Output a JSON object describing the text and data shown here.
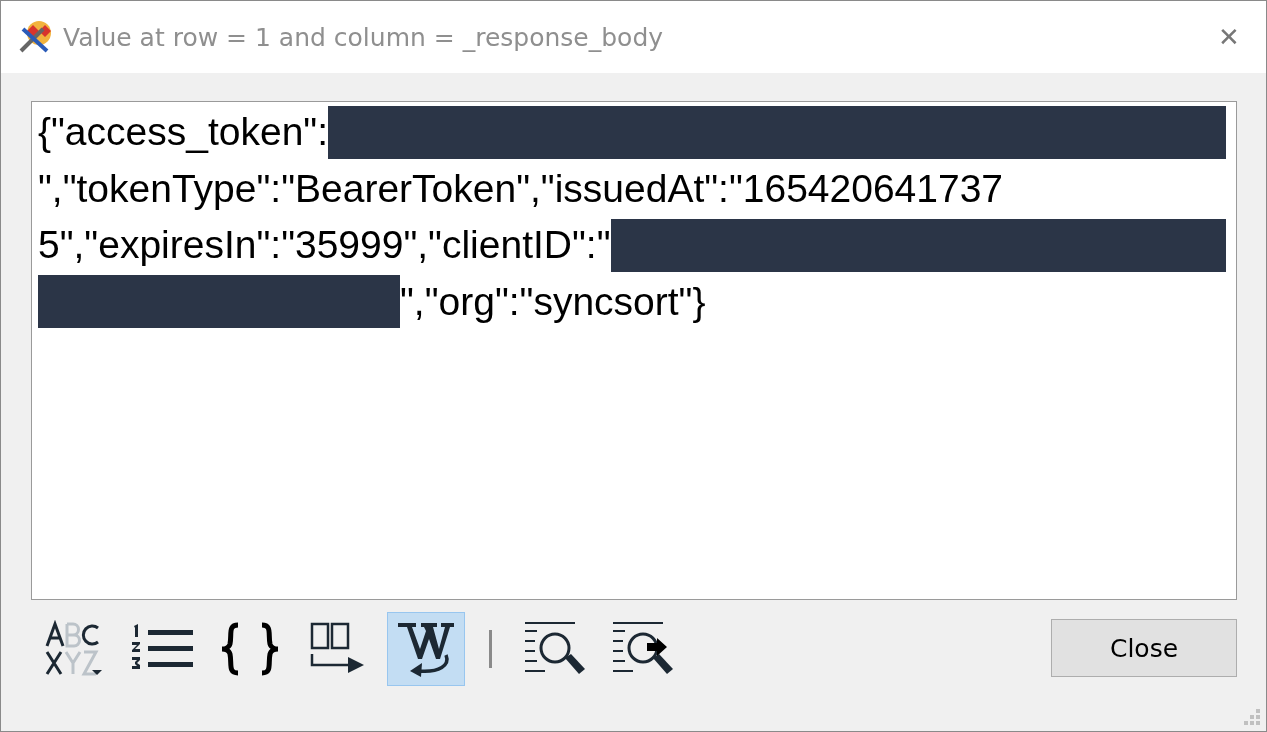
{
  "window": {
    "title": "Value at row = 1 and column = _response_body",
    "close_glyph": "✕"
  },
  "content": {
    "lines": [
      [
        {
          "kind": "text",
          "text": "{\"access_token\":"
        },
        {
          "kind": "redacted"
        }
      ],
      [
        {
          "kind": "text",
          "text": "\",\"tokenType\":\"BearerToken\",\"issuedAt\":\"165420641737"
        }
      ],
      [
        {
          "kind": "text",
          "text": "5\",\"expiresIn\":\"35999\",\"clientID\":\""
        },
        {
          "kind": "redacted"
        }
      ],
      [
        {
          "kind": "redacted"
        },
        {
          "kind": "text",
          "text": "\",\"org\":\"syncsort\"}"
        }
      ]
    ]
  },
  "toolbar": [
    {
      "kind": "case",
      "selected": false
    },
    {
      "kind": "numbers",
      "selected": false
    },
    {
      "kind": "braces",
      "selected": false
    },
    {
      "kind": "columns",
      "selected": false
    },
    {
      "kind": "wrap",
      "selected": true
    },
    {
      "kind": "separator"
    },
    {
      "kind": "find",
      "selected": false
    },
    {
      "kind": "find-next",
      "selected": false
    }
  ],
  "buttons": [
    "Close"
  ]
}
